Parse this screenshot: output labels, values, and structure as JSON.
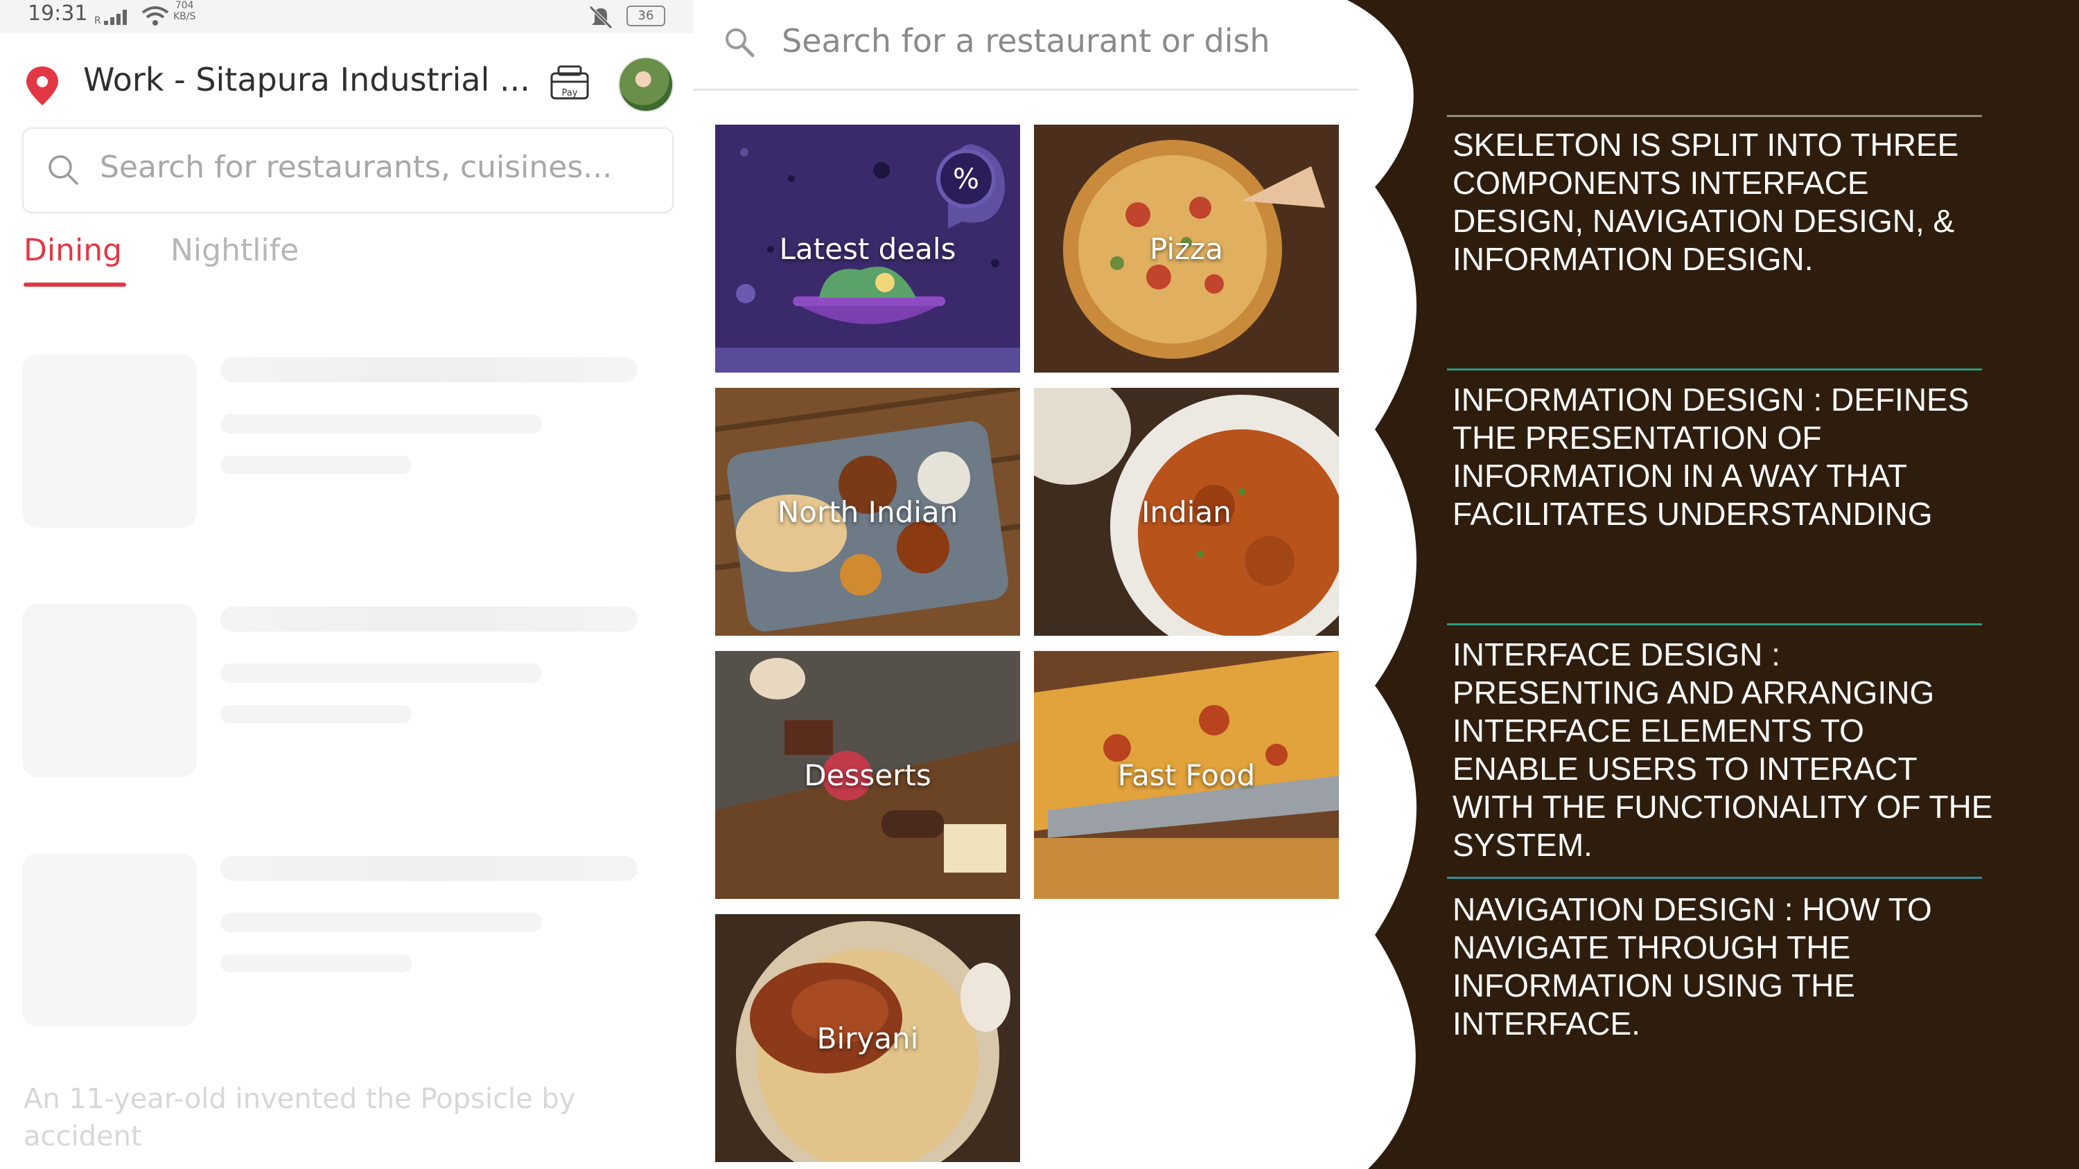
{
  "status_bar": {
    "time": "19:31",
    "net_speed_value": "704",
    "net_speed_unit": "KB/S",
    "battery": "36"
  },
  "location": {
    "label": "Work - Sitapura Industrial ..."
  },
  "search": {
    "placeholder": "Search for restaurants, cuisines..."
  },
  "tabs": [
    {
      "label": "Dining",
      "active": true
    },
    {
      "label": "Nightlife",
      "active": false
    }
  ],
  "loading_fact": "An 11-year-old invented the Popsicle by accident",
  "category_search": {
    "placeholder": "Search for a restaurant or dish"
  },
  "categories": [
    {
      "label": "Latest deals"
    },
    {
      "label": "Pizza"
    },
    {
      "label": "North Indian"
    },
    {
      "label": "Indian"
    },
    {
      "label": "Desserts"
    },
    {
      "label": "Fast Food"
    },
    {
      "label": "Biryani"
    }
  ],
  "slide_text": [
    "SKELETON IS SPLIT INTO THREE COMPONENTS INTERFACE DESIGN, NAVIGATION DESIGN, & INFORMATION DESIGN.",
    "INFORMATION DESIGN : DEFINES THE PRESENTATION OF INFORMATION IN A WAY THAT FACILITATES UNDERSTANDING",
    "INTERFACE DESIGN : PRESENTING AND ARRANGING INTERFACE ELEMENTS TO ENABLE USERS TO INTERACT WITH THE FUNCTIONALITY OF THE SYSTEM.",
    "NAVIGATION DESIGN : HOW TO NAVIGATE THROUGH THE INFORMATION USING THE INTERFACE."
  ],
  "icons": [
    "location-pin-icon",
    "pay-icon",
    "search-icon",
    "percent-badge-icon",
    "wifi-icon",
    "signal-icon",
    "mute-icon",
    "battery-icon"
  ],
  "colors": {
    "brand_red": "#e23744",
    "slide_bg": "#2e1d0d",
    "rule_green": "#2f9a7e",
    "rule_teal": "#2b8fa0",
    "deals_purple": "#3b2a6b"
  }
}
